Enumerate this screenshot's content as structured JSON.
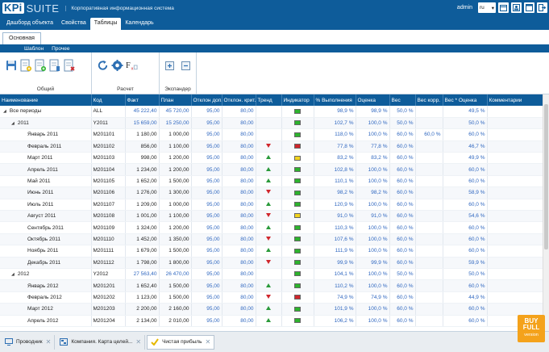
{
  "app": {
    "logo_kpi": "KPi",
    "logo_suite": "SUITE",
    "tagline": "Корпоративная информационная система",
    "user": "admin",
    "lang": "ru"
  },
  "nav": {
    "tabs": [
      "Дашборд объекта",
      "Свойства",
      "Таблицы",
      "Календарь"
    ],
    "active": "Таблицы"
  },
  "ribbon": {
    "tabs": [
      "Основная"
    ],
    "subtabs": [
      "Шаблон",
      "Прочее"
    ],
    "groups": [
      "Общий",
      "Расчет",
      "Экспандер"
    ]
  },
  "table": {
    "columns": [
      "Наименование",
      "Код",
      "Факт",
      "План",
      "Отклон доп.",
      "Отклон. крит.",
      "Тренд",
      "Индикатор",
      "% Выполнения",
      "Оценка",
      "Вес",
      "Вес корр.",
      "Вес * Оценка",
      "Комментарии"
    ],
    "rows": [
      {
        "name": "Все периоды",
        "lvl": 0,
        "exp": "◢",
        "code": "ALL",
        "fact": "45 222,40",
        "plan": "45 720,00",
        "dev1": "95,00",
        "dev2": "80,00",
        "trend": "",
        "ind": "#2db32d",
        "pct": "98,9 %",
        "score": "98,9 %",
        "w": "50,0 %",
        "wc": "",
        "ws": "49,5 %",
        "blue": true
      },
      {
        "name": "2011",
        "lvl": 1,
        "exp": "◢",
        "code": "Y2011",
        "fact": "15 659,00",
        "plan": "15 250,00",
        "dev1": "95,00",
        "dev2": "80,00",
        "trend": "",
        "ind": "#2db32d",
        "pct": "102,7 %",
        "score": "100,0 %",
        "w": "50,0 %",
        "wc": "",
        "ws": "50,0 %",
        "blue": true
      },
      {
        "name": "Январь 2011",
        "lvl": 2,
        "exp": "",
        "code": "M201101",
        "fact": "1 180,00",
        "plan": "1 000,00",
        "dev1": "95,00",
        "dev2": "80,00",
        "trend": "",
        "ind": "#2db32d",
        "pct": "118,0 %",
        "score": "100,0 %",
        "w": "60,0 %",
        "wc": "60,0 %",
        "ws": "60,0 %",
        "blue": false
      },
      {
        "name": "Февраль 2011",
        "lvl": 2,
        "exp": "",
        "code": "M201102",
        "fact": "856,00",
        "plan": "1 100,00",
        "dev1": "95,00",
        "dev2": "80,00",
        "trend": "down",
        "ind": "#d0262c",
        "pct": "77,8 %",
        "score": "77,8 %",
        "w": "60,0 %",
        "wc": "",
        "ws": "46,7 %",
        "blue": false
      },
      {
        "name": "Март 2011",
        "lvl": 2,
        "exp": "",
        "code": "M201103",
        "fact": "998,00",
        "plan": "1 200,00",
        "dev1": "95,00",
        "dev2": "80,00",
        "trend": "up",
        "ind": "#f1d31e",
        "pct": "83,2 %",
        "score": "83,2 %",
        "w": "60,0 %",
        "wc": "",
        "ws": "49,9 %",
        "blue": false
      },
      {
        "name": "Апрель 2011",
        "lvl": 2,
        "exp": "",
        "code": "M201104",
        "fact": "1 234,00",
        "plan": "1 200,00",
        "dev1": "95,00",
        "dev2": "80,00",
        "trend": "up",
        "ind": "#2db32d",
        "pct": "102,8 %",
        "score": "100,0 %",
        "w": "60,0 %",
        "wc": "",
        "ws": "60,0 %",
        "blue": false
      },
      {
        "name": "Май 2011",
        "lvl": 2,
        "exp": "",
        "code": "M201105",
        "fact": "1 652,00",
        "plan": "1 500,00",
        "dev1": "95,00",
        "dev2": "80,00",
        "trend": "up",
        "ind": "#2db32d",
        "pct": "110,1 %",
        "score": "100,0 %",
        "w": "60,0 %",
        "wc": "",
        "ws": "60,0 %",
        "blue": false
      },
      {
        "name": "Июнь 2011",
        "lvl": 2,
        "exp": "",
        "code": "M201106",
        "fact": "1 276,00",
        "plan": "1 300,00",
        "dev1": "95,00",
        "dev2": "80,00",
        "trend": "down",
        "ind": "#2db32d",
        "pct": "98,2 %",
        "score": "98,2 %",
        "w": "60,0 %",
        "wc": "",
        "ws": "58,9 %",
        "blue": false
      },
      {
        "name": "Июль 2011",
        "lvl": 2,
        "exp": "",
        "code": "M201107",
        "fact": "1 209,00",
        "plan": "1 000,00",
        "dev1": "95,00",
        "dev2": "80,00",
        "trend": "up",
        "ind": "#2db32d",
        "pct": "120,9 %",
        "score": "100,0 %",
        "w": "60,0 %",
        "wc": "",
        "ws": "60,0 %",
        "blue": false
      },
      {
        "name": "Август 2011",
        "lvl": 2,
        "exp": "",
        "code": "M201108",
        "fact": "1 001,00",
        "plan": "1 100,00",
        "dev1": "95,00",
        "dev2": "80,00",
        "trend": "down",
        "ind": "#f1d31e",
        "pct": "91,0 %",
        "score": "91,0 %",
        "w": "60,0 %",
        "wc": "",
        "ws": "54,6 %",
        "blue": false
      },
      {
        "name": "Сентябрь 2011",
        "lvl": 2,
        "exp": "",
        "code": "M201109",
        "fact": "1 324,00",
        "plan": "1 200,00",
        "dev1": "95,00",
        "dev2": "80,00",
        "trend": "up",
        "ind": "#2db32d",
        "pct": "110,3 %",
        "score": "100,0 %",
        "w": "60,0 %",
        "wc": "",
        "ws": "60,0 %",
        "blue": false
      },
      {
        "name": "Октябрь 2011",
        "lvl": 2,
        "exp": "",
        "code": "M201110",
        "fact": "1 452,00",
        "plan": "1 350,00",
        "dev1": "95,00",
        "dev2": "80,00",
        "trend": "down",
        "ind": "#2db32d",
        "pct": "107,6 %",
        "score": "100,0 %",
        "w": "60,0 %",
        "wc": "",
        "ws": "60,0 %",
        "blue": false
      },
      {
        "name": "Ноябрь 2011",
        "lvl": 2,
        "exp": "",
        "code": "M201111",
        "fact": "1 679,00",
        "plan": "1 500,00",
        "dev1": "95,00",
        "dev2": "80,00",
        "trend": "up",
        "ind": "#2db32d",
        "pct": "111,9 %",
        "score": "100,0 %",
        "w": "60,0 %",
        "wc": "",
        "ws": "60,0 %",
        "blue": false
      },
      {
        "name": "Декабрь 2011",
        "lvl": 2,
        "exp": "",
        "code": "M201112",
        "fact": "1 798,00",
        "plan": "1 800,00",
        "dev1": "95,00",
        "dev2": "80,00",
        "trend": "down",
        "ind": "#2db32d",
        "pct": "99,9 %",
        "score": "99,9 %",
        "w": "60,0 %",
        "wc": "",
        "ws": "59,9 %",
        "blue": false
      },
      {
        "name": "2012",
        "lvl": 1,
        "exp": "◢",
        "code": "Y2012",
        "fact": "27 563,40",
        "plan": "26 470,00",
        "dev1": "95,00",
        "dev2": "80,00",
        "trend": "",
        "ind": "#2db32d",
        "pct": "104,1 %",
        "score": "100,0 %",
        "w": "50,0 %",
        "wc": "",
        "ws": "50,0 %",
        "blue": true
      },
      {
        "name": "Январь 2012",
        "lvl": 2,
        "exp": "",
        "code": "M201201",
        "fact": "1 652,40",
        "plan": "1 500,00",
        "dev1": "95,00",
        "dev2": "80,00",
        "trend": "up",
        "ind": "#2db32d",
        "pct": "110,2 %",
        "score": "100,0 %",
        "w": "60,0 %",
        "wc": "",
        "ws": "60,0 %",
        "blue": false
      },
      {
        "name": "Февраль 2012",
        "lvl": 2,
        "exp": "",
        "code": "M201202",
        "fact": "1 123,00",
        "plan": "1 500,00",
        "dev1": "95,00",
        "dev2": "80,00",
        "trend": "down",
        "ind": "#d0262c",
        "pct": "74,9 %",
        "score": "74,9 %",
        "w": "60,0 %",
        "wc": "",
        "ws": "44,9 %",
        "blue": false
      },
      {
        "name": "Март 2012",
        "lvl": 2,
        "exp": "",
        "code": "M201203",
        "fact": "2 200,00",
        "plan": "2 160,00",
        "dev1": "95,00",
        "dev2": "80,00",
        "trend": "up",
        "ind": "#2db32d",
        "pct": "101,9 %",
        "score": "100,0 %",
        "w": "60,0 %",
        "wc": "",
        "ws": "60,0 %",
        "blue": false
      },
      {
        "name": "Апрель 2012",
        "lvl": 2,
        "exp": "",
        "code": "M201204",
        "fact": "2 134,00",
        "plan": "2 010,00",
        "dev1": "95,00",
        "dev2": "80,00",
        "trend": "up",
        "ind": "#2db32d",
        "pct": "106,2 %",
        "score": "100,0 %",
        "w": "60,0 %",
        "wc": "",
        "ws": "60,0 %",
        "blue": false
      }
    ]
  },
  "taskbar": {
    "tabs": [
      "Проводник",
      "Компания. Карта целей...",
      "Чистая прибыль"
    ],
    "active": "Чистая прибыль"
  },
  "badge": {
    "line1": "BUY",
    "line2": "FULL",
    "line3": "version"
  },
  "colors": {
    "brand": "#0e5c9a",
    "green": "#2db32d",
    "red": "#d0262c",
    "yellow": "#f1d31e",
    "badge": "#f4a21b"
  }
}
